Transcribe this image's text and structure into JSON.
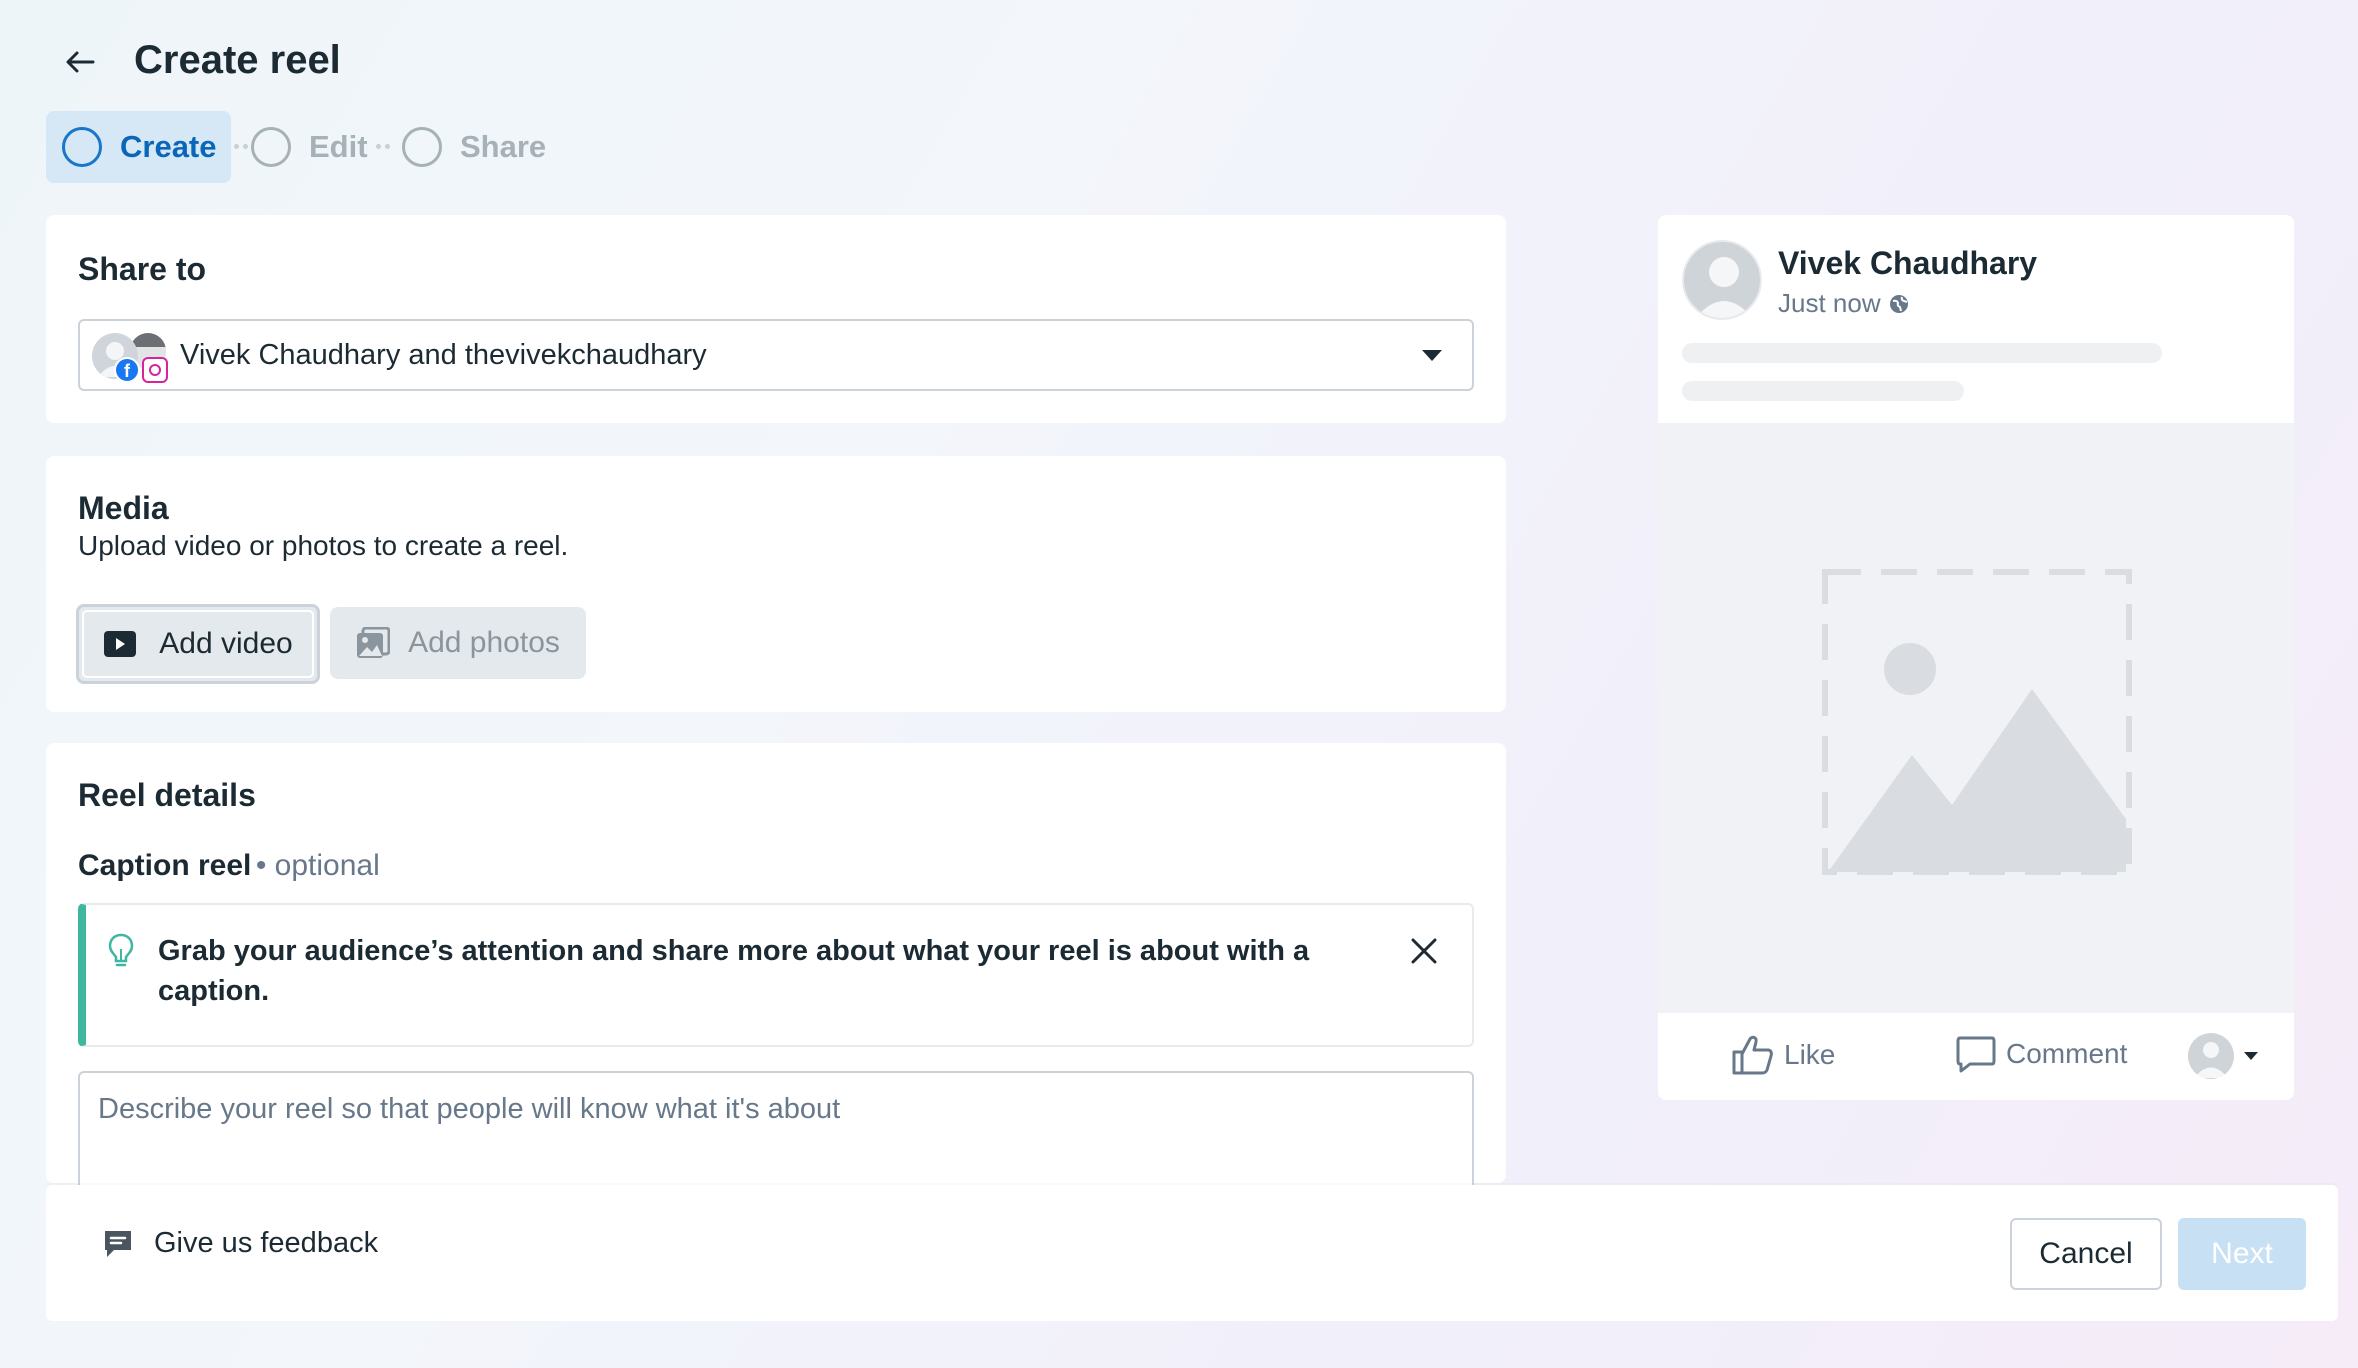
{
  "header": {
    "title": "Create reel"
  },
  "stepper": {
    "steps": [
      {
        "label": "Create",
        "state": "active"
      },
      {
        "label": "Edit",
        "state": "inactive"
      },
      {
        "label": "Share",
        "state": "inactive"
      }
    ]
  },
  "share_to": {
    "title": "Share to",
    "selected": "Vivek Chaudhary and thevivekchaudhary"
  },
  "media": {
    "title": "Media",
    "subtitle": "Upload video or photos to create a reel.",
    "add_video_label": "Add video",
    "add_photos_label": "Add photos"
  },
  "reel_details": {
    "title": "Reel details",
    "caption_label": "Caption reel",
    "caption_optional": "optional",
    "tip_text": "Grab your audience’s attention and share more about what your reel is about with a caption.",
    "caption_placeholder": "Describe your reel so that people will know what it's about",
    "caption_value": ""
  },
  "footer": {
    "feedback_label": "Give us feedback",
    "cancel_label": "Cancel",
    "next_label": "Next"
  },
  "preview": {
    "author": "Vivek Chaudhary",
    "time": "Just now",
    "like_label": "Like",
    "comment_label": "Comment"
  },
  "colors": {
    "accent": "#1877c9",
    "active_step_bg": "#d6e7f5",
    "tip_accent": "#3fb7a0",
    "next_disabled": "#c7e0f4"
  }
}
